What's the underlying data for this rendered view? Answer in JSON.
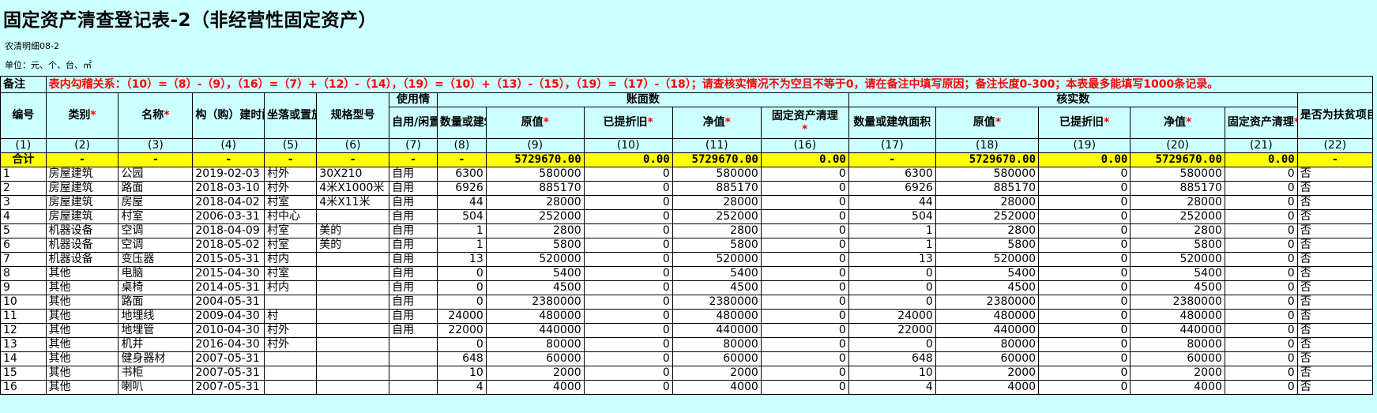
{
  "title": "固定资产清查登记表-2（非经营性固定资产）",
  "form_code": "农清明细08-2",
  "unit": "单位：元、个、台、㎡",
  "note_label": "备注",
  "note_text": "表内勾稽关系：（10）=（8）-（9），（16）=（7）+（12）-（14），（19）=（10）+（13）-（15），（19）=（17）-（18）；请查核实情况不为空且不等于0，请在备注中填写原因；备注长度0-300；本表最多能填写1000条记录。",
  "headers": {
    "id": "编号",
    "category": "类别",
    "name": "名称",
    "build_time": "构（购）建时间",
    "location": "坐落或置放位置",
    "spec": "规格型号",
    "usage_group": "使用情",
    "usage": "自用/闲置/其他",
    "book_group": "账面数",
    "book_qty": "数量或建筑面",
    "book_orig": "原值",
    "book_dep": "已提折旧",
    "book_net": "净值",
    "book_clean": "固定资产清理",
    "check_group": "核实数",
    "check_qty": "数量或建筑面积",
    "check_orig": "原值",
    "check_dep": "已提折旧",
    "check_net": "净值",
    "check_clean": "固定资产清理",
    "poverty": "是否为扶贫项目形成资产",
    "remark": "备注",
    "req": "*"
  },
  "col_numbers": [
    "(1)",
    "(2)",
    "(3)",
    "(4)",
    "(5)",
    "(6)",
    "(7)",
    "(8)",
    "(9)",
    "(10)",
    "(11)",
    "(16)",
    "(17)",
    "(18)",
    "(19)",
    "(20)",
    "(21)",
    "(22)"
  ],
  "total": {
    "label": "合计",
    "dash": "-",
    "book_orig": "5729670.00",
    "book_dep": "0.00",
    "book_net": "5729670.00",
    "book_clean": "0.00",
    "check_orig": "5729670.00",
    "check_dep": "0.00",
    "check_net": "5729670.00",
    "check_clean": "0.00"
  },
  "rows": [
    {
      "id": "1",
      "cat": "房屋建筑",
      "name": "公园",
      "time": "2019-02-03",
      "loc": "村外",
      "spec": "30X210",
      "use": "自用",
      "bq": "6300",
      "bo": "580000",
      "bd": "0",
      "bn": "580000",
      "bc": "0",
      "cq": "6300",
      "co": "580000",
      "cd": "0",
      "cn": "580000",
      "cc": "0",
      "pov": "否"
    },
    {
      "id": "2",
      "cat": "房屋建筑",
      "name": "路面",
      "time": "2018-03-10",
      "loc": "村外",
      "spec": "4米X1000米",
      "use": "自用",
      "bq": "6926",
      "bo": "885170",
      "bd": "0",
      "bn": "885170",
      "bc": "0",
      "cq": "6926",
      "co": "885170",
      "cd": "0",
      "cn": "885170",
      "cc": "0",
      "pov": "否"
    },
    {
      "id": "3",
      "cat": "房屋建筑",
      "name": "房屋",
      "time": "2018-04-02",
      "loc": "村室",
      "spec": "4米X11米",
      "use": "自用",
      "bq": "44",
      "bo": "28000",
      "bd": "0",
      "bn": "28000",
      "bc": "0",
      "cq": "44",
      "co": "28000",
      "cd": "0",
      "cn": "28000",
      "cc": "0",
      "pov": "否"
    },
    {
      "id": "4",
      "cat": "房屋建筑",
      "name": "村室",
      "time": "2006-03-31",
      "loc": "村中心",
      "spec": "",
      "use": "自用",
      "bq": "504",
      "bo": "252000",
      "bd": "0",
      "bn": "252000",
      "bc": "0",
      "cq": "504",
      "co": "252000",
      "cd": "0",
      "cn": "252000",
      "cc": "0",
      "pov": "否"
    },
    {
      "id": "5",
      "cat": "机器设备",
      "name": "空调",
      "time": "2018-04-09",
      "loc": "村室",
      "spec": "美的",
      "use": "自用",
      "bq": "1",
      "bo": "2800",
      "bd": "0",
      "bn": "2800",
      "bc": "0",
      "cq": "1",
      "co": "2800",
      "cd": "0",
      "cn": "2800",
      "cc": "0",
      "pov": "否"
    },
    {
      "id": "6",
      "cat": "机器设备",
      "name": "空调",
      "time": "2018-05-02",
      "loc": "村室",
      "spec": "美的",
      "use": "自用",
      "bq": "1",
      "bo": "5800",
      "bd": "0",
      "bn": "5800",
      "bc": "0",
      "cq": "1",
      "co": "5800",
      "cd": "0",
      "cn": "5800",
      "cc": "0",
      "pov": "否"
    },
    {
      "id": "7",
      "cat": "机器设备",
      "name": "变压器",
      "time": "2015-05-31",
      "loc": "村内",
      "spec": "",
      "use": "自用",
      "bq": "13",
      "bo": "520000",
      "bd": "0",
      "bn": "520000",
      "bc": "0",
      "cq": "13",
      "co": "520000",
      "cd": "0",
      "cn": "520000",
      "cc": "0",
      "pov": "否"
    },
    {
      "id": "8",
      "cat": "其他",
      "name": "电脑",
      "time": "2015-04-30",
      "loc": "村室",
      "spec": "",
      "use": "自用",
      "bq": "0",
      "bo": "5400",
      "bd": "0",
      "bn": "5400",
      "bc": "0",
      "cq": "0",
      "co": "5400",
      "cd": "0",
      "cn": "5400",
      "cc": "0",
      "pov": "否"
    },
    {
      "id": "9",
      "cat": "其他",
      "name": "桌椅",
      "time": "2014-05-31",
      "loc": "村内",
      "spec": "",
      "use": "自用",
      "bq": "0",
      "bo": "4500",
      "bd": "0",
      "bn": "4500",
      "bc": "0",
      "cq": "0",
      "co": "4500",
      "cd": "0",
      "cn": "4500",
      "cc": "0",
      "pov": "否"
    },
    {
      "id": "10",
      "cat": "其他",
      "name": "路面",
      "time": "2004-05-31",
      "loc": "",
      "spec": "",
      "use": "自用",
      "bq": "0",
      "bo": "2380000",
      "bd": "0",
      "bn": "2380000",
      "bc": "0",
      "cq": "0",
      "co": "2380000",
      "cd": "0",
      "cn": "2380000",
      "cc": "0",
      "pov": "否"
    },
    {
      "id": "11",
      "cat": "其他",
      "name": "地埋线",
      "time": "2009-04-30",
      "loc": "村",
      "spec": "",
      "use": "自用",
      "bq": "24000",
      "bo": "480000",
      "bd": "0",
      "bn": "480000",
      "bc": "0",
      "cq": "24000",
      "co": "480000",
      "cd": "0",
      "cn": "480000",
      "cc": "0",
      "pov": "否"
    },
    {
      "id": "12",
      "cat": "其他",
      "name": "地埋管",
      "time": "2010-04-30",
      "loc": "村外",
      "spec": "",
      "use": "自用",
      "bq": "22000",
      "bo": "440000",
      "bd": "0",
      "bn": "440000",
      "bc": "0",
      "cq": "22000",
      "co": "440000",
      "cd": "0",
      "cn": "440000",
      "cc": "0",
      "pov": "否"
    },
    {
      "id": "13",
      "cat": "其他",
      "name": "机井",
      "time": "2016-04-30",
      "loc": "村外",
      "spec": "",
      "use": "",
      "bq": "0",
      "bo": "80000",
      "bd": "0",
      "bn": "80000",
      "bc": "0",
      "cq": "0",
      "co": "80000",
      "cd": "0",
      "cn": "80000",
      "cc": "0",
      "pov": "否"
    },
    {
      "id": "14",
      "cat": "其他",
      "name": "健身器材",
      "time": "2007-05-31",
      "loc": "",
      "spec": "",
      "use": "",
      "bq": "648",
      "bo": "60000",
      "bd": "0",
      "bn": "60000",
      "bc": "0",
      "cq": "648",
      "co": "60000",
      "cd": "0",
      "cn": "60000",
      "cc": "0",
      "pov": "否"
    },
    {
      "id": "15",
      "cat": "其他",
      "name": "书柜",
      "time": "2007-05-31",
      "loc": "",
      "spec": "",
      "use": "",
      "bq": "10",
      "bo": "2000",
      "bd": "0",
      "bn": "2000",
      "bc": "0",
      "cq": "10",
      "co": "2000",
      "cd": "0",
      "cn": "2000",
      "cc": "0",
      "pov": "否"
    },
    {
      "id": "16",
      "cat": "其他",
      "name": "喇叭",
      "time": "2007-05-31",
      "loc": "",
      "spec": "",
      "use": "",
      "bq": "4",
      "bo": "4000",
      "bd": "0",
      "bn": "4000",
      "bc": "0",
      "cq": "4",
      "co": "4000",
      "cd": "0",
      "cn": "4000",
      "cc": "0",
      "pov": "否"
    }
  ]
}
